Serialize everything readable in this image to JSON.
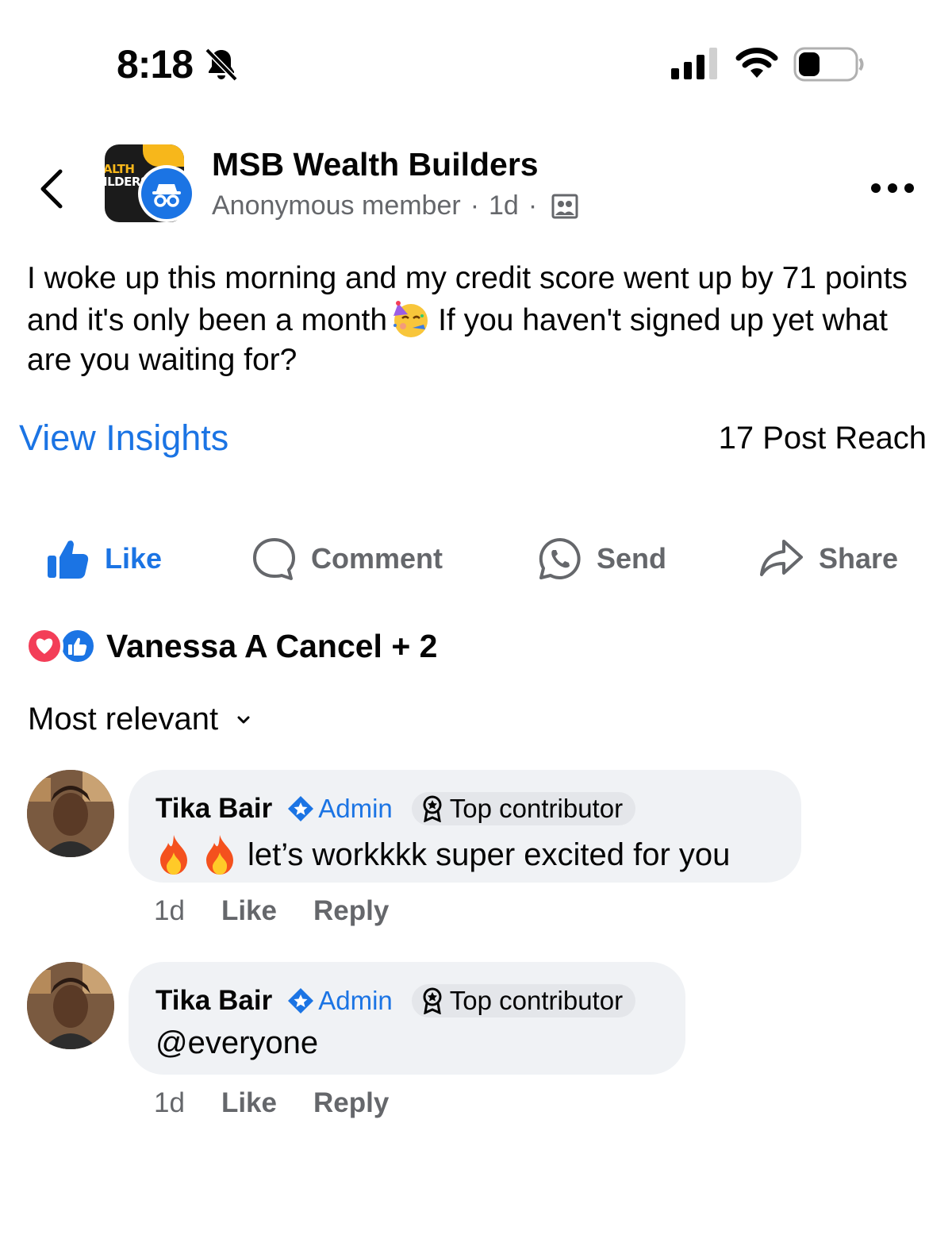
{
  "status_bar": {
    "time": "8:18",
    "icons": [
      "bell-off-icon",
      "signal-icon",
      "wifi-icon",
      "battery-icon"
    ]
  },
  "header": {
    "group_name": "MSB Wealth Builders",
    "group_logo_text_line1": "ALTH",
    "group_logo_text_line2": "ILDERS",
    "author": "Anonymous member",
    "time": "1d",
    "separator": "·"
  },
  "post": {
    "text_before_emoji": "I woke up this morning and my credit score went up by 71 points and it's only been a month",
    "text_after_emoji": "If you haven't signed up yet what are you waiting for?",
    "emoji": "partying-face"
  },
  "insights": {
    "link_label": "View Insights",
    "reach": "17 Post Reach"
  },
  "actions": {
    "like": "Like",
    "comment": "Comment",
    "send": "Send",
    "share": "Share"
  },
  "reactions": {
    "summary": "Vanessa A Cancel + 2",
    "types": [
      "love",
      "like"
    ]
  },
  "sort": {
    "label": "Most relevant"
  },
  "comments": [
    {
      "name": "Tika Bair",
      "admin": "Admin",
      "badge": "Top contributor",
      "text": "let’s workkkk super excited for you",
      "emoji_prefix": "fire-fire",
      "time": "1d",
      "like": "Like",
      "reply": "Reply"
    },
    {
      "name": "Tika Bair",
      "admin": "Admin",
      "badge": "Top contributor",
      "text": "@everyone",
      "time": "1d",
      "like": "Like",
      "reply": "Reply"
    }
  ],
  "colors": {
    "brand_blue": "#1b74e4",
    "secondary_text": "#65676b",
    "bubble_bg": "#f0f2f5",
    "love_red": "#f33e58"
  }
}
